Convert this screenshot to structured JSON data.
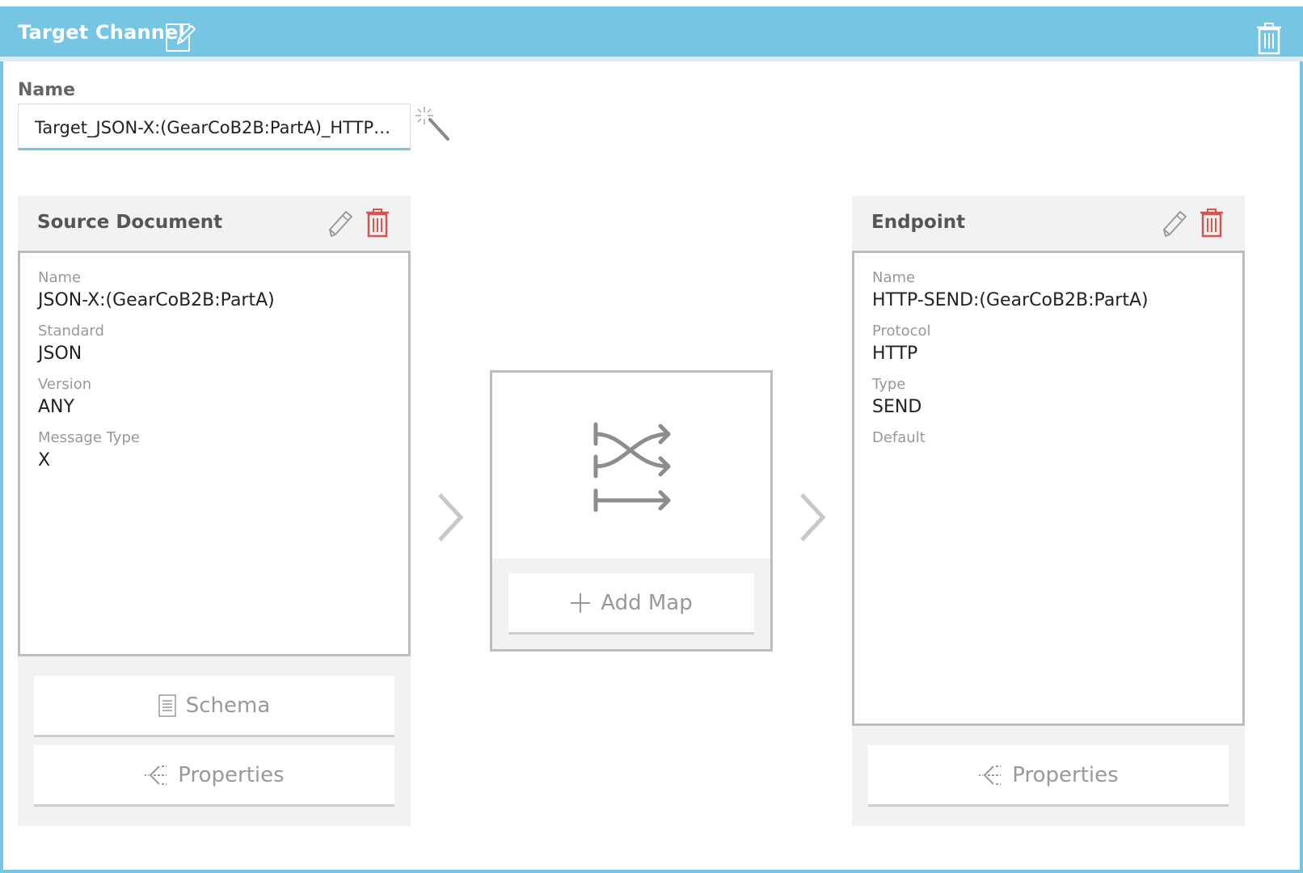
{
  "header": {
    "title": "Target Channel"
  },
  "name_field": {
    "label": "Name",
    "value": "Target_JSON-X:(GearCoB2B:PartA)_HTTP:(..."
  },
  "source_document": {
    "title": "Source Document",
    "fields": [
      {
        "label": "Name",
        "value": "JSON-X:(GearCoB2B:PartA)"
      },
      {
        "label": "Standard",
        "value": "JSON"
      },
      {
        "label": "Version",
        "value": "ANY"
      },
      {
        "label": "Message Type",
        "value": "X"
      }
    ],
    "buttons": {
      "schema": "Schema",
      "properties": "Properties"
    }
  },
  "map": {
    "add_label": "Add Map"
  },
  "endpoint": {
    "title": "Endpoint",
    "fields": [
      {
        "label": "Name",
        "value": "HTTP-SEND:(GearCoB2B:PartA)"
      },
      {
        "label": "Protocol",
        "value": "HTTP"
      },
      {
        "label": "Type",
        "value": "SEND"
      },
      {
        "label": "Default",
        "value": ""
      }
    ],
    "buttons": {
      "properties": "Properties"
    }
  },
  "colors": {
    "header_bg": "#76c5e3",
    "trash_red": "#d9534f",
    "icon_gray": "#9a9a9a"
  },
  "icons": {
    "header_edit": "edit-icon",
    "header_delete": "trash-icon",
    "name_generate": "magic-wand-icon",
    "panel_edit": "pencil-icon",
    "panel_delete": "trash-icon",
    "map": "shuffle-icon",
    "schema": "document-icon",
    "properties": "hierarchy-icon",
    "add": "plus-icon",
    "flow": "chevron-right-icon"
  }
}
